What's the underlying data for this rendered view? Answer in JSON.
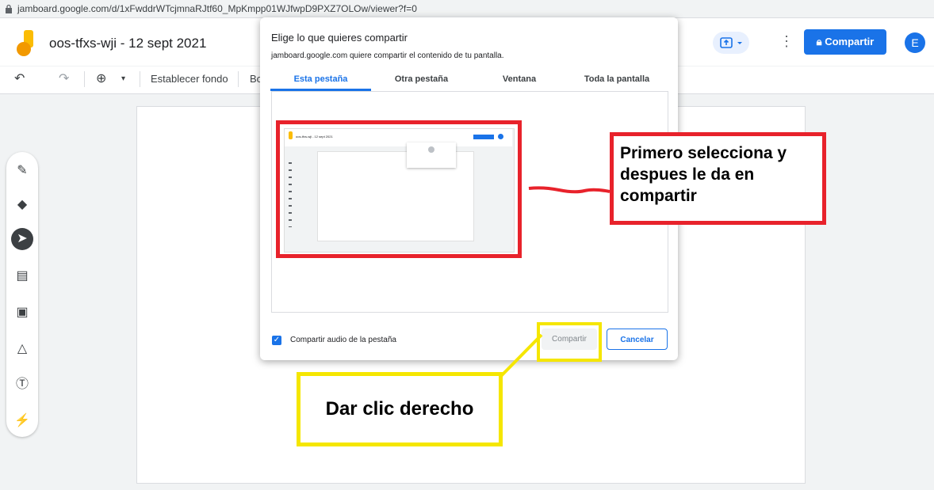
{
  "browser": {
    "url": "jamboard.google.com/d/1xFwddrWTcjmnaRJtf60_MpKmpp01WJfwpD9PXZ7OLOw/viewer?f=0"
  },
  "app": {
    "doc_title": "oos-tfxs-wji - 12 sept 2021",
    "share_button": "Compartir",
    "avatar_letter": "E"
  },
  "toolbar": {
    "undo_icon": "undo-icon",
    "redo_icon": "redo-icon",
    "zoom_icon": "zoom-icon",
    "set_background": "Establecer fondo",
    "clear_frame_partial": "Bo"
  },
  "tools": [
    "pen-icon",
    "eraser-icon",
    "select-icon",
    "sticky-note-icon",
    "image-icon",
    "shape-icon",
    "text-box-icon",
    "laser-icon"
  ],
  "dialog": {
    "title": "Elige lo que quieres compartir",
    "subtitle": "jamboard.google.com quiere compartir el contenido de tu pantalla.",
    "tabs": [
      "Esta pestaña",
      "Otra pestaña",
      "Ventana",
      "Toda la pantalla"
    ],
    "preview_title": "oos-tfxs-wji - 12 sept 2021",
    "checkbox_label": "Compartir audio de la pestaña",
    "share_button": "Compartir",
    "cancel_button": "Cancelar"
  },
  "annotations": {
    "red_note": "Primero selecciona y despues le da en compartir",
    "yellow_note": "Dar clic derecho"
  },
  "colors": {
    "accent": "#1a73e8",
    "annotation_red": "#e8222b",
    "annotation_yellow": "#f5e600"
  }
}
